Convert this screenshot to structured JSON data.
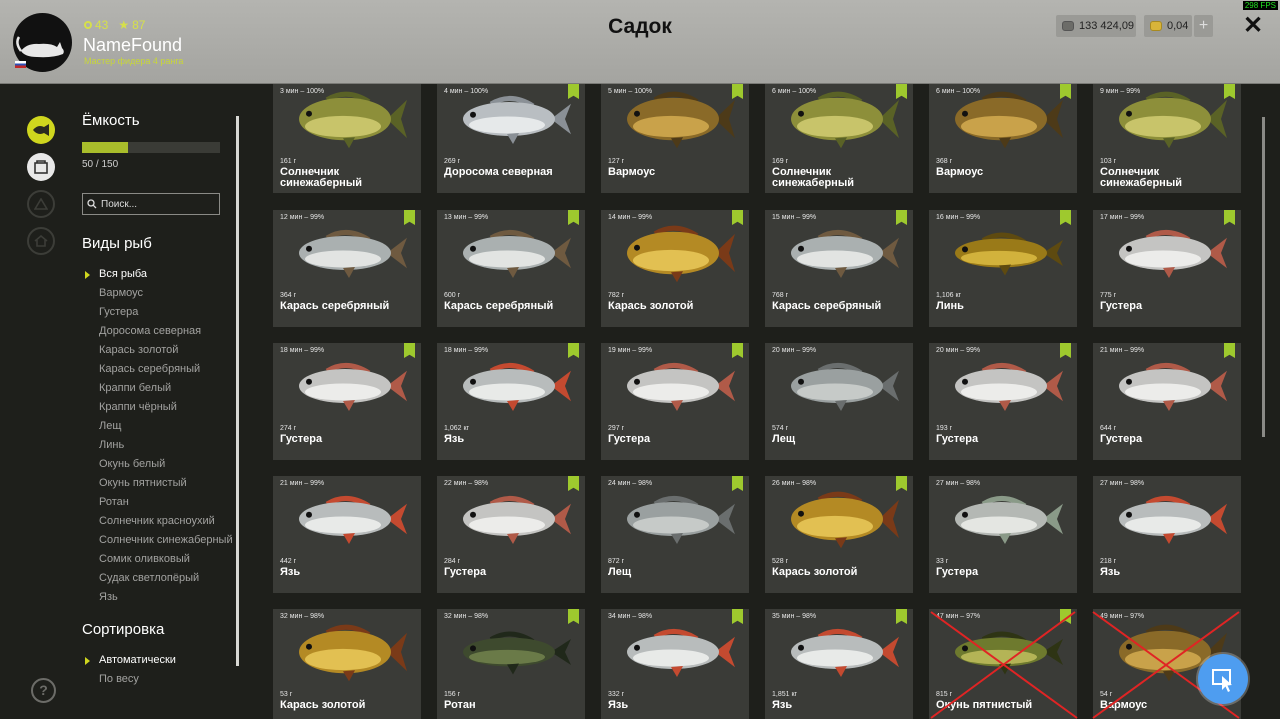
{
  "header": {
    "title": "Садок",
    "username": "NameFound",
    "rank": "Мастер фидера 4 ранга",
    "level": "43",
    "stars": "87",
    "silver": "133 424,09",
    "gold": "0,04",
    "plus": "+",
    "close": "✕",
    "fps": "298 FPS"
  },
  "sidebar": {
    "capacity_title": "Ёмкость",
    "capacity_text": "50 / 150",
    "capacity_fraction": 0.333,
    "search_placeholder": "Поиск...",
    "species_title": "Виды рыб",
    "species": [
      "Вся рыба",
      "Вармоус",
      "Густера",
      "Доросома северная",
      "Карась золотой",
      "Карась серебряный",
      "Краппи белый",
      "Краппи чёрный",
      "Лещ",
      "Линь",
      "Окунь белый",
      "Окунь пятнистый",
      "Ротан",
      "Солнечник красноухий",
      "Солнечник синежаберный",
      "Сомик оливковый",
      "Судак светлопёрый",
      "Язь"
    ],
    "sort_title": "Сортировка",
    "sort_selected": "Автоматически",
    "sort_next": "По весу"
  },
  "colors": {
    "accent": "#cfd61e",
    "check": "#9ec92e",
    "card": "#3a3b37",
    "cross": "#e02424",
    "pointer": "#4e9df0"
  },
  "cards": [
    {
      "time": "3 мин – 100%",
      "weight": "161 г",
      "name": "Солнечник синежаберный",
      "fish": "sunfish",
      "checked": false
    },
    {
      "time": "4 мин – 100%",
      "weight": "269 г",
      "name": "Доросома северная",
      "fish": "shad",
      "checked": true
    },
    {
      "time": "5 мин – 100%",
      "weight": "127 г",
      "name": "Вармоус",
      "fish": "warmouth",
      "checked": true
    },
    {
      "time": "6 мин – 100%",
      "weight": "169 г",
      "name": "Солнечник синежаберный",
      "fish": "sunfish",
      "checked": true
    },
    {
      "time": "6 мин – 100%",
      "weight": "368 г",
      "name": "Вармоус",
      "fish": "warmouth",
      "checked": true
    },
    {
      "time": "9 мин – 99%",
      "weight": "103 г",
      "name": "Солнечник синежаберный",
      "fish": "sunfish",
      "checked": true
    },
    {
      "time": "12 мин – 99%",
      "weight": "364 г",
      "name": "Карась серебряный",
      "fish": "silvercarp",
      "checked": true
    },
    {
      "time": "13 мин – 99%",
      "weight": "600 г",
      "name": "Карась серебряный",
      "fish": "silvercarp",
      "checked": true
    },
    {
      "time": "14 мин – 99%",
      "weight": "782 г",
      "name": "Карась золотой",
      "fish": "goldcarp",
      "checked": true
    },
    {
      "time": "15 мин – 99%",
      "weight": "768 г",
      "name": "Карась серебряный",
      "fish": "silvercarp",
      "checked": true
    },
    {
      "time": "16 мин – 99%",
      "weight": "1,106 кг",
      "name": "Линь",
      "fish": "tench",
      "checked": true
    },
    {
      "time": "17 мин – 99%",
      "weight": "775 г",
      "name": "Густера",
      "fish": "bream",
      "checked": true
    },
    {
      "time": "18 мин – 99%",
      "weight": "274 г",
      "name": "Густера",
      "fish": "bream",
      "checked": true
    },
    {
      "time": "18 мин – 99%",
      "weight": "1,062 кг",
      "name": "Язь",
      "fish": "ide",
      "checked": true
    },
    {
      "time": "19 мин – 99%",
      "weight": "297 г",
      "name": "Густера",
      "fish": "bream",
      "checked": true
    },
    {
      "time": "20 мин – 99%",
      "weight": "574 г",
      "name": "Лещ",
      "fish": "bigbream",
      "checked": false
    },
    {
      "time": "20 мин – 99%",
      "weight": "193 г",
      "name": "Густера",
      "fish": "bream",
      "checked": true
    },
    {
      "time": "21 мин – 99%",
      "weight": "644 г",
      "name": "Густера",
      "fish": "bream",
      "checked": true
    },
    {
      "time": "21 мин – 99%",
      "weight": "442 г",
      "name": "Язь",
      "fish": "ide",
      "checked": false
    },
    {
      "time": "22 мин – 98%",
      "weight": "284 г",
      "name": "Густера",
      "fish": "bream",
      "checked": true
    },
    {
      "time": "24 мин – 98%",
      "weight": "872 г",
      "name": "Лещ",
      "fish": "bigbream",
      "checked": true
    },
    {
      "time": "26 мин – 98%",
      "weight": "528 г",
      "name": "Карась золотой",
      "fish": "goldcarp",
      "checked": true
    },
    {
      "time": "27 мин – 98%",
      "weight": "33 г",
      "name": "Густера",
      "fish": "roach",
      "checked": false
    },
    {
      "time": "27 мин – 98%",
      "weight": "218 г",
      "name": "Язь",
      "fish": "ide",
      "checked": false
    },
    {
      "time": "32 мин – 98%",
      "weight": "53 г",
      "name": "Карась золотой",
      "fish": "goldcarp",
      "checked": false
    },
    {
      "time": "32 мин – 98%",
      "weight": "156 г",
      "name": "Ротан",
      "fish": "rotan",
      "checked": true
    },
    {
      "time": "34 мин – 98%",
      "weight": "332 г",
      "name": "Язь",
      "fish": "ide",
      "checked": true
    },
    {
      "time": "35 мин – 98%",
      "weight": "1,851 кг",
      "name": "Язь",
      "fish": "ide",
      "checked": true
    },
    {
      "time": "47 мин – 97%",
      "weight": "815 г",
      "name": "Окунь пятнистый",
      "fish": "bass",
      "checked": true
    },
    {
      "time": "49 мин – 97%",
      "weight": "54 г",
      "name": "Вармоус",
      "fish": "warmouth",
      "checked": false
    }
  ]
}
